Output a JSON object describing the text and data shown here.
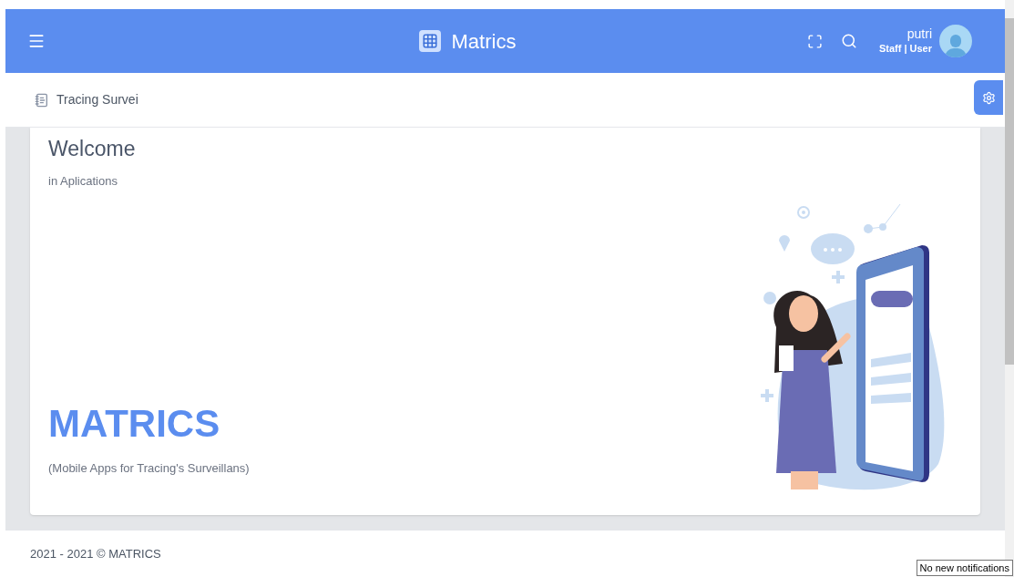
{
  "header": {
    "title": "Matrics",
    "user": {
      "name": "putri",
      "role": "Staff | User"
    }
  },
  "breadcrumb": {
    "label": "Tracing Survei"
  },
  "welcome": {
    "heading": "Welcome",
    "subheading": "in Aplications",
    "brand": "MATRICS",
    "tagline": "(Mobile Apps for Tracing's Surveillans)"
  },
  "footer": {
    "text": "2021 - 2021 © MATRICS"
  },
  "tooltip": {
    "text": "No new notifications"
  }
}
